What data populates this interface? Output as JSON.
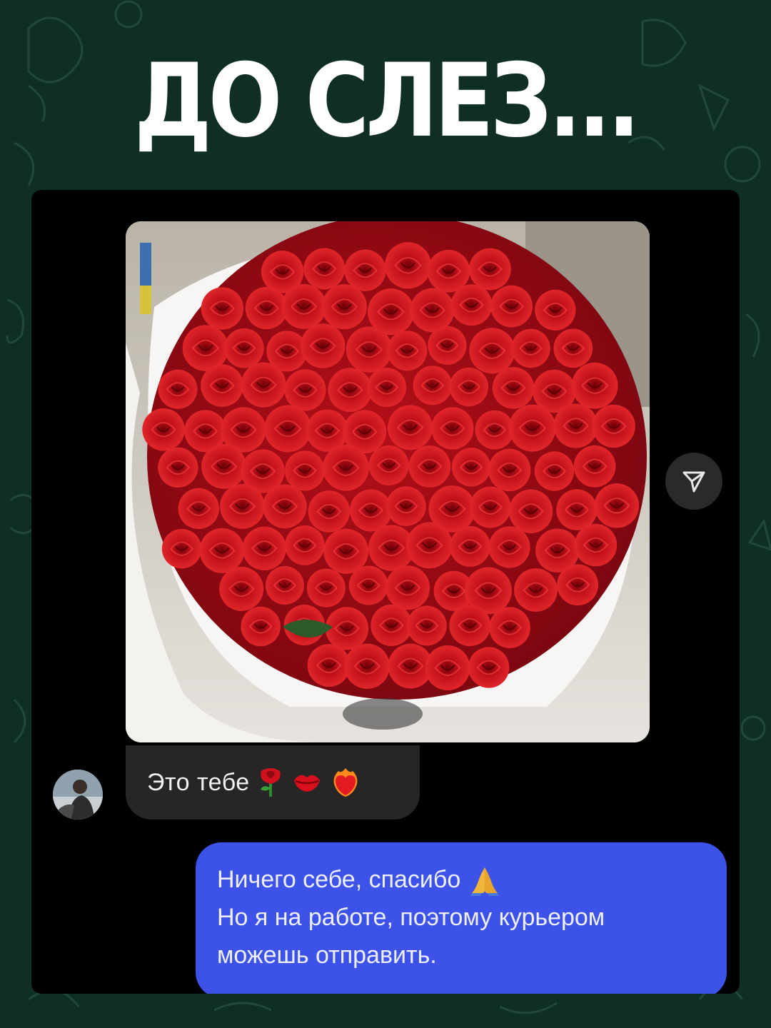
{
  "headline": "ДО СЛЕЗ...",
  "chat": {
    "image": {
      "subject": "bouquet of red roses in white wrapping",
      "share_icon": "paper-plane-icon"
    },
    "incoming": {
      "avatar_icon": "user-avatar",
      "text": "Это тебе",
      "emojis": [
        "rose-emoji",
        "kiss-mark-emoji",
        "heart-on-fire-emoji"
      ]
    },
    "outgoing": {
      "line1": "Ничего себе, спасибо",
      "line1_emoji": "folded-hands-emoji",
      "line2": "Но я на работе, поэтому курьером",
      "line3": "можешь отправить."
    }
  },
  "colors": {
    "background": "#0f2e26",
    "card": "#000000",
    "incoming_bubble": "#262626",
    "outgoing_bubble": "#3d52e8",
    "roses": "#c8101a"
  }
}
